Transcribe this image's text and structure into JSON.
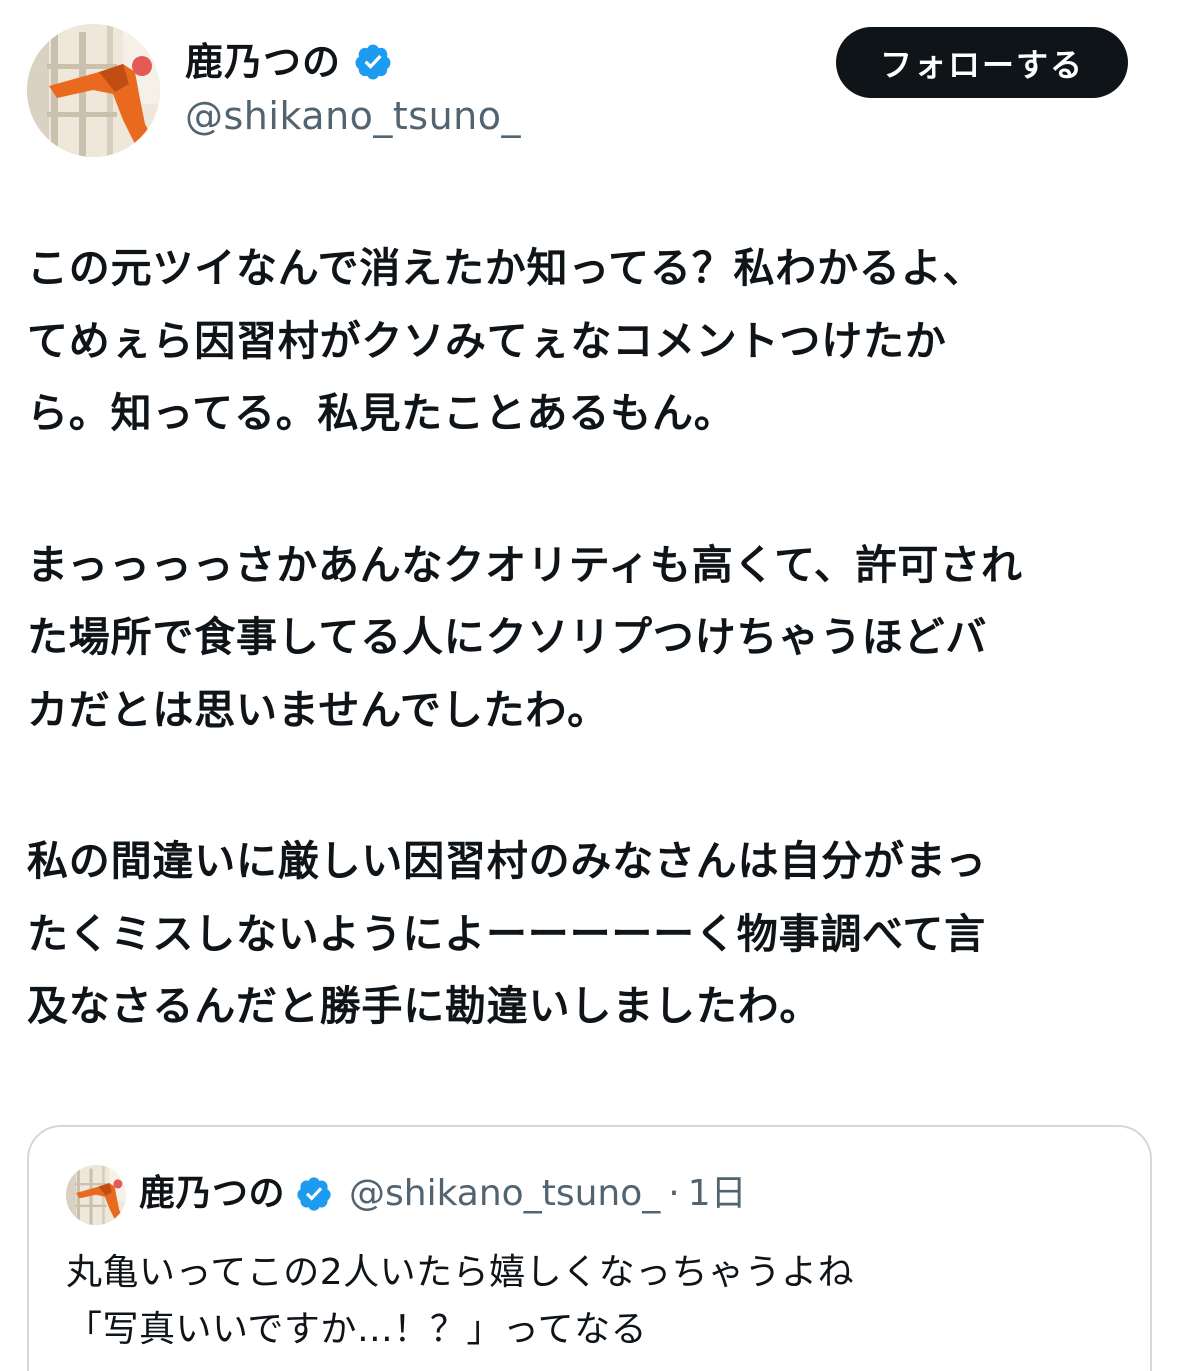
{
  "author": {
    "display_name": "鹿乃つの",
    "handle": "@shikano_tsuno_",
    "verified_icon": "verified-badge-icon",
    "avatar": "avatar-image"
  },
  "follow_button": {
    "label": "フォローする"
  },
  "tweet": {
    "paragraphs": [
      [
        "この元ツイなんで消えたか知ってる？私わかるよ、",
        "てめぇら因習村がクソみてぇなコメントつけたか",
        "ら。知ってる。私見たことあるもん。"
      ],
      [
        "まっっっっさかあんなクオリティも高くて、許可され",
        "た場所で食事してる人にクソリプつけちゃうほどバ",
        "カだとは思いませんでしたわ。"
      ],
      [
        "私の間違いに厳しい因習村のみなさんは自分がまっ",
        "たくミスしないようによーーーーーく物事調べて言",
        "及なさるんだと勝手に勘違いしましたわ。"
      ]
    ]
  },
  "quoted_tweet": {
    "display_name": "鹿乃つの",
    "handle": "@shikano_tsuno_",
    "separator": "·",
    "time": "1日",
    "lines": [
      "丸亀いってこの2人いたら嬉しくなっちゃうよね",
      "「写真いいですか…！？」ってなる"
    ]
  },
  "colors": {
    "text": "#0f1419",
    "secondary": "#536471",
    "verified": "#1d9bf0",
    "button_bg": "#0f1419",
    "border": "#cfd9de"
  }
}
